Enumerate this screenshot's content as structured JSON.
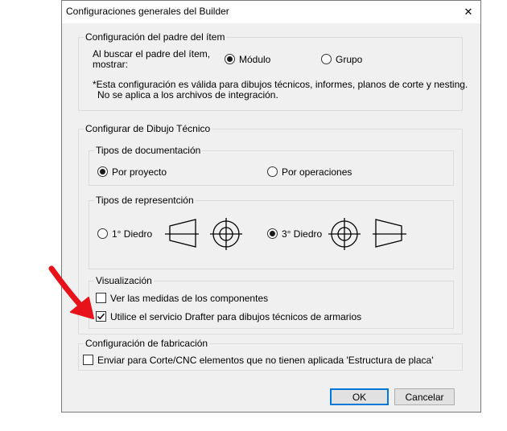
{
  "dialog": {
    "title": "Configuraciones generales del Builder",
    "close_glyph": "✕"
  },
  "parent_group": {
    "legend": "Configuración del padre del ítem",
    "prompt_line1": "Al buscar el padre del ítem,",
    "prompt_line2": "mostrar:",
    "options": [
      {
        "label": "Módulo",
        "checked": true
      },
      {
        "label": "Grupo",
        "checked": false
      }
    ],
    "note_line1": "*Esta configuración es válida para dibujos técnicos, informes, planos de corte y nesting.",
    "note_line2": "No se aplica a los archivos de integración."
  },
  "drawing_group": {
    "legend": "Configurar de Dibujo Técnico",
    "doc_types": {
      "legend": "Tipos de documentación",
      "options": [
        {
          "label": "Por proyecto",
          "checked": true
        },
        {
          "label": "Por operaciones",
          "checked": false
        }
      ]
    },
    "rep_types": {
      "legend": "Tipos de representción",
      "options": [
        {
          "label": "1° Diedro",
          "checked": false
        },
        {
          "label": "3° Diedro",
          "checked": true
        }
      ],
      "icons": [
        "first-angle-projection-icon",
        "third-angle-projection-icon"
      ]
    },
    "visualization": {
      "legend": "Visualización",
      "options": [
        {
          "label": "Ver las medidas de los componentes",
          "checked": false
        },
        {
          "label": "Utilice el servicio Drafter para dibujos técnicos de armarios",
          "checked": true
        }
      ]
    }
  },
  "fab_group": {
    "legend": "Configuración de fabricación",
    "option": {
      "label": "Enviar para Corte/CNC elementos que no tienen aplicada 'Estructura de placa'",
      "checked": false
    }
  },
  "buttons": {
    "ok": "OK",
    "cancel": "Cancelar"
  },
  "annotation": {
    "arrow_color": "#e8121b",
    "icon": "red-arrow-icon"
  }
}
